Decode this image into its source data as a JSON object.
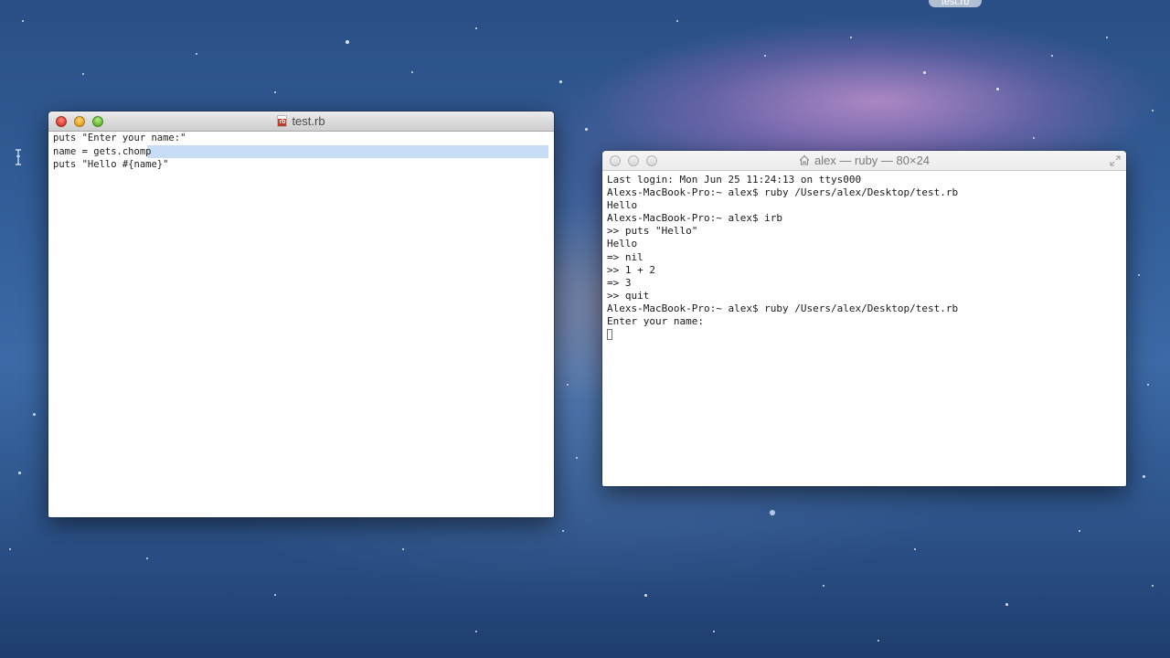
{
  "desktop": {
    "file_label": "test.rb"
  },
  "editor": {
    "title": "test.rb",
    "file_icon": "ruby-file-icon",
    "lines": [
      "puts \"Enter your name:\"",
      "name = gets.chomp",
      "puts \"Hello #{name}\""
    ],
    "selected_line_index": 1
  },
  "terminal": {
    "title": "alex — ruby — 80×24",
    "title_icon": "home-icon",
    "lines": [
      "Last login: Mon Jun 25 11:24:13 on ttys000",
      "Alexs-MacBook-Pro:~ alex$ ruby /Users/alex/Desktop/test.rb",
      "Hello",
      "Alexs-MacBook-Pro:~ alex$ irb",
      ">> puts \"Hello\"",
      "Hello",
      "=> nil",
      ">> 1 + 2",
      "=> 3",
      ">> quit",
      "Alexs-MacBook-Pro:~ alex$ ruby /Users/alex/Desktop/test.rb",
      "Enter your name:"
    ]
  },
  "colors": {
    "selection": "#c7dcf5",
    "close": "#e0443a",
    "minimize": "#e8a82a",
    "zoom": "#6cbd3a"
  }
}
